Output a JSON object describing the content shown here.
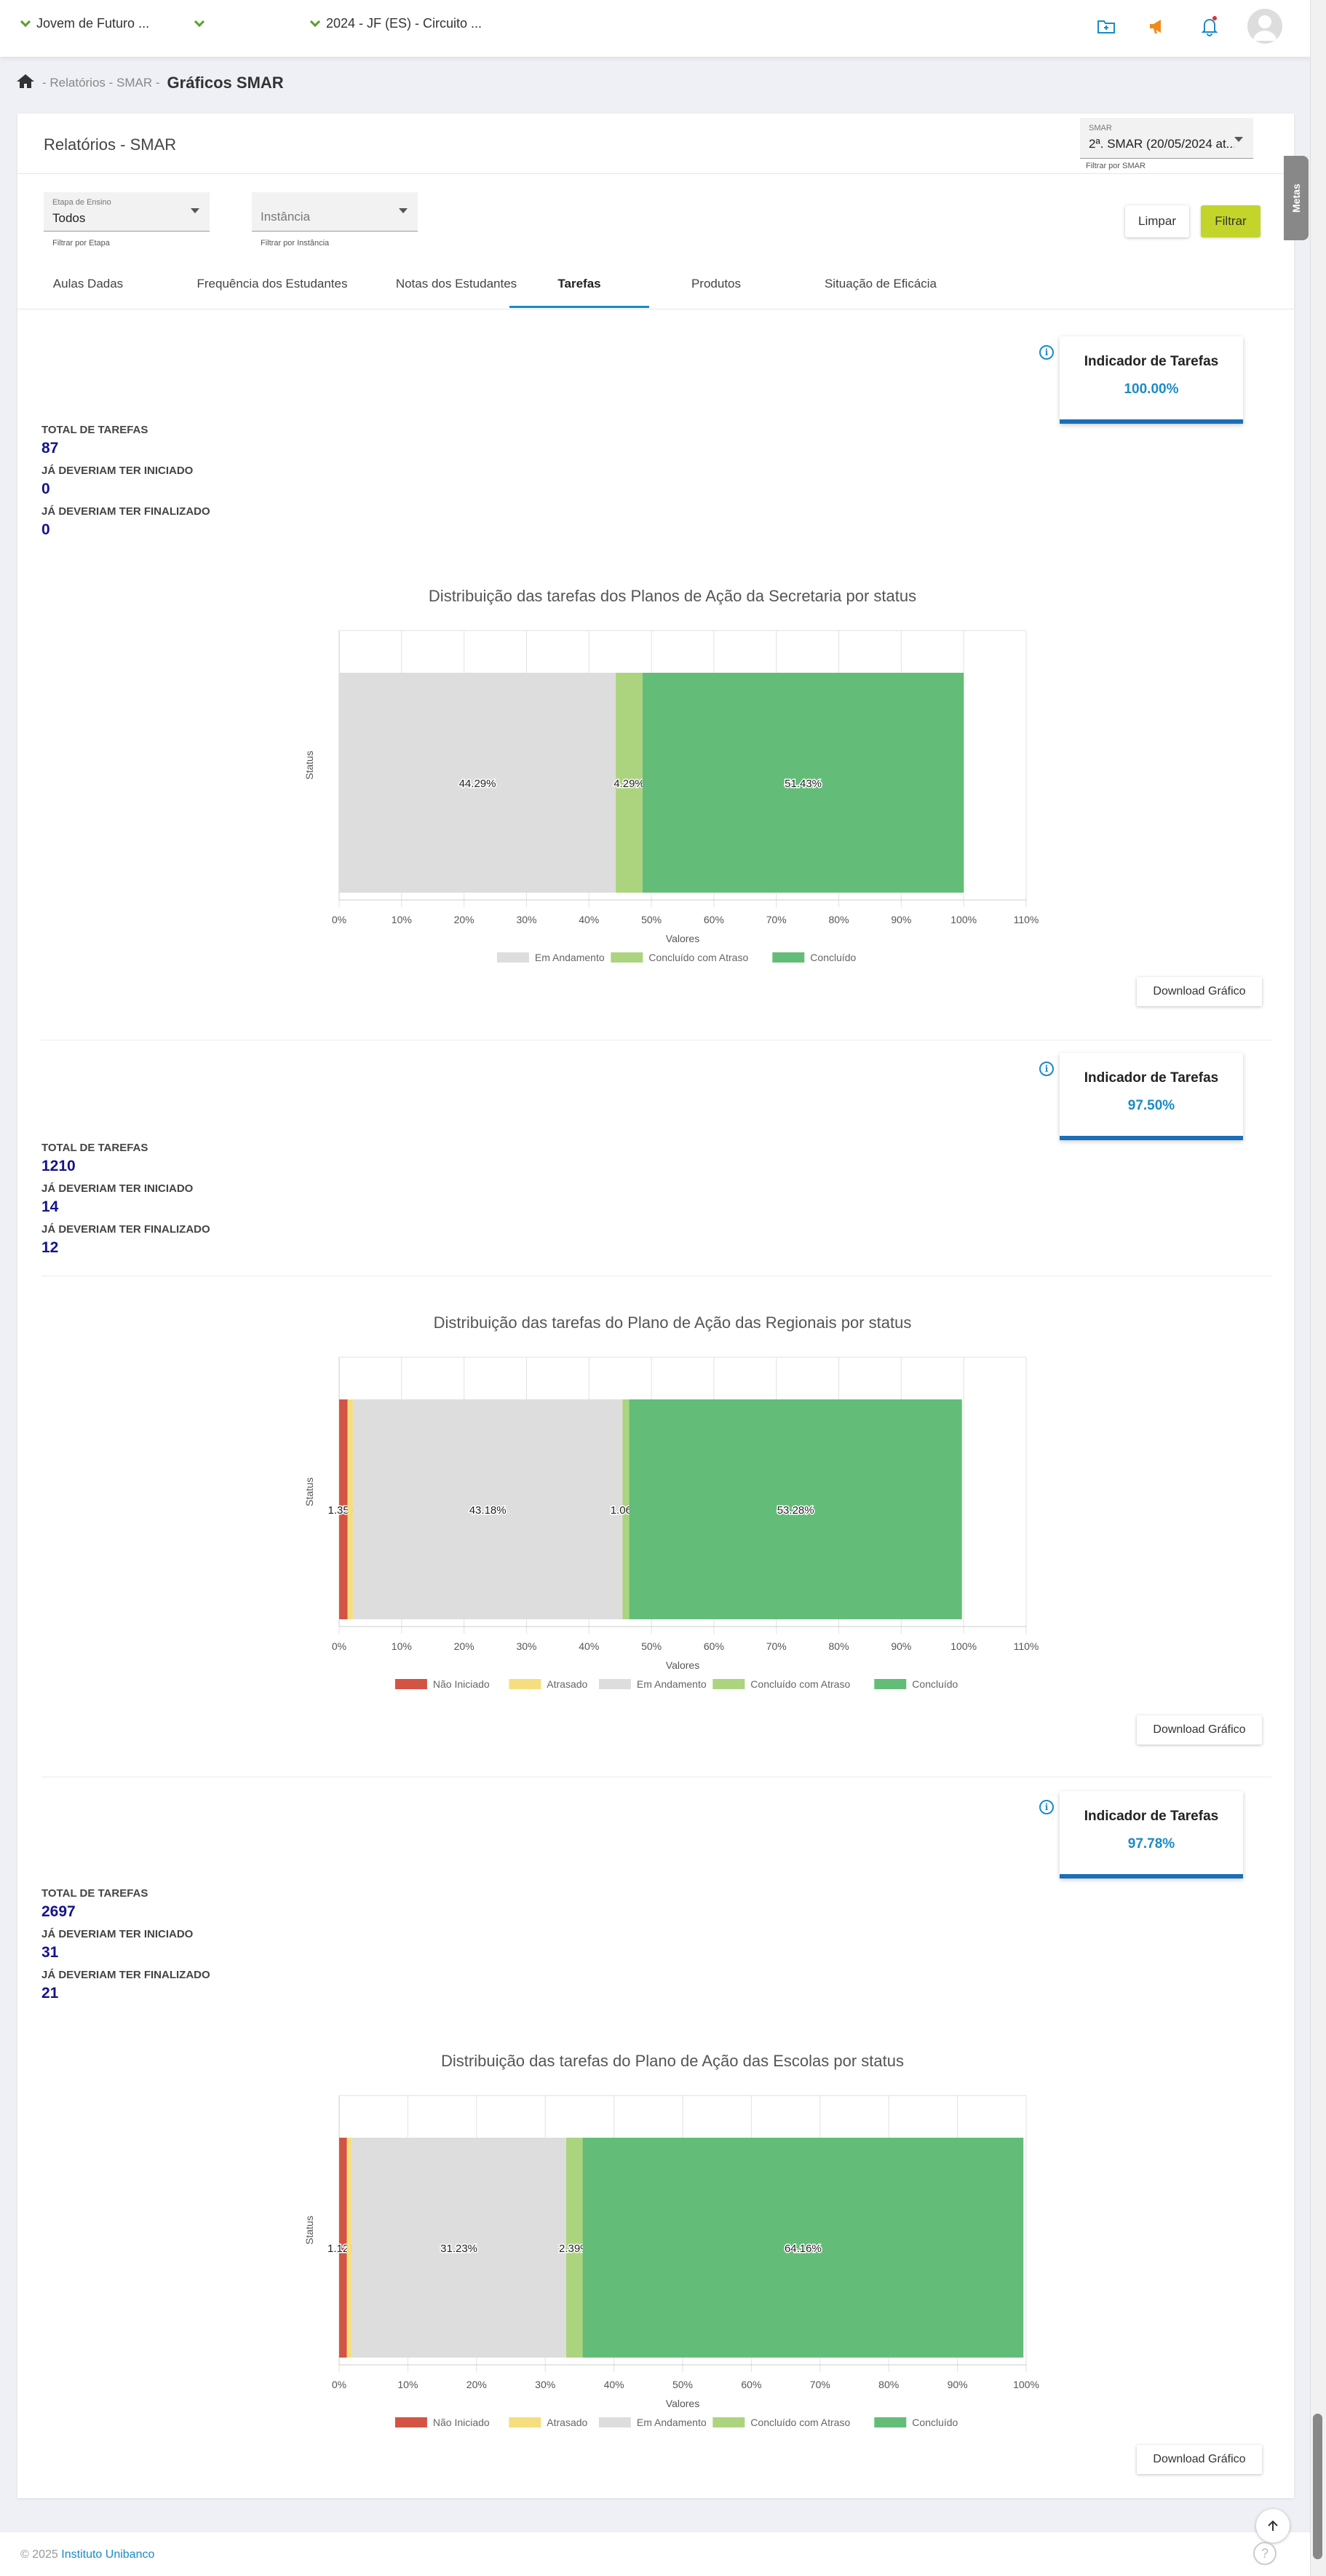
{
  "topbar": {
    "program_select": "Jovem de Futuro ...",
    "cycle_select": "2024 - JF (ES) - Circuito ...",
    "icons": [
      "folder-icon",
      "megaphone-icon",
      "bell-icon",
      "avatar-icon"
    ]
  },
  "metas_tab": "Metas",
  "breadcrumb": {
    "parent": "- Relatórios - SMAR -",
    "current": "Gráficos SMAR"
  },
  "card": {
    "title": "Relatórios - SMAR",
    "smar_filter": {
      "label": "SMAR",
      "value": "2ª. SMAR (20/05/2024 at...",
      "hint": "Filtrar por SMAR"
    },
    "etapa_filter": {
      "label": "Etapa de Ensino",
      "value": "Todos",
      "hint": "Filtrar por Etapa"
    },
    "instancia_filter": {
      "placeholder": "Instância",
      "hint": "Filtrar por Instância"
    },
    "clear_label": "Limpar",
    "filter_label": "Filtrar"
  },
  "tabs": [
    "Aulas Dadas",
    "Frequência dos Estudantes",
    "Notas dos Estudantes",
    "Tarefas",
    "Produtos",
    "Situação de Eficácia"
  ],
  "active_tab": "Tarefas",
  "sections": [
    {
      "indicator_title": "Indicador de Tarefas",
      "indicator_value": "100.00%",
      "stats": [
        {
          "label": "TOTAL DE TAREFAS",
          "value": "87"
        },
        {
          "label": "JÁ DEVERIAM TER INICIADO",
          "value": "0"
        },
        {
          "label": "JÁ DEVERIAM TER FINALIZADO",
          "value": "0"
        }
      ],
      "download_label": "Download Gráfico"
    },
    {
      "indicator_title": "Indicador de Tarefas",
      "indicator_value": "97.50%",
      "stats": [
        {
          "label": "TOTAL DE TAREFAS",
          "value": "1210"
        },
        {
          "label": "JÁ DEVERIAM TER INICIADO",
          "value": "14"
        },
        {
          "label": "JÁ DEVERIAM TER FINALIZADO",
          "value": "12"
        }
      ],
      "download_label": "Download Gráfico"
    },
    {
      "indicator_title": "Indicador de Tarefas",
      "indicator_value": "97.78%",
      "stats": [
        {
          "label": "TOTAL DE TAREFAS",
          "value": "2697"
        },
        {
          "label": "JÁ DEVERIAM TER INICIADO",
          "value": "31"
        },
        {
          "label": "JÁ DEVERIAM TER FINALIZADO",
          "value": "21"
        }
      ],
      "download_label": "Download Gráfico"
    }
  ],
  "chart_data": [
    {
      "type": "bar",
      "orientation": "horizontal-stacked",
      "title": "Distribuição das tarefas dos Planos de Ação da Secretaria por status",
      "xlabel": "Valores",
      "ylabel": "Status",
      "xlim": [
        0,
        110
      ],
      "xticks": [
        "0%",
        "10%",
        "20%",
        "30%",
        "40%",
        "50%",
        "60%",
        "70%",
        "80%",
        "90%",
        "100%",
        "110%"
      ],
      "series": [
        {
          "name": "Em Andamento",
          "value": 44.29,
          "label": "44.29%",
          "color": "#dddddd"
        },
        {
          "name": "Concluído com Atraso",
          "value": 4.29,
          "label": "4.29%",
          "color": "#acd47f"
        },
        {
          "name": "Concluído",
          "value": 51.43,
          "label": "51.43%",
          "color": "#63bd79"
        }
      ],
      "legend": [
        "Em Andamento",
        "Concluído com Atraso",
        "Concluído"
      ],
      "legend_position": "bottom",
      "grid": true
    },
    {
      "type": "bar",
      "orientation": "horizontal-stacked",
      "title": "Distribuição das tarefas do Plano de Ação das Regionais por status",
      "xlabel": "Valores",
      "ylabel": "Status",
      "xlim": [
        0,
        110
      ],
      "xticks": [
        "0%",
        "10%",
        "20%",
        "30%",
        "40%",
        "50%",
        "60%",
        "70%",
        "80%",
        "90%",
        "100%",
        "110%"
      ],
      "series": [
        {
          "name": "Não Iniciado",
          "value": 1.35,
          "label": "1.35%",
          "color": "#d35444"
        },
        {
          "name": "Atrasado",
          "value": 0.85,
          "label": "",
          "color": "#f6de7f"
        },
        {
          "name": "Em Andamento",
          "value": 43.18,
          "label": "43.18%",
          "color": "#dddddd"
        },
        {
          "name": "Concluído com Atraso",
          "value": 1.06,
          "label": "1.06%",
          "color": "#acd47f"
        },
        {
          "name": "Concluído",
          "value": 53.28,
          "label": "53.28%",
          "color": "#63bd79"
        }
      ],
      "legend": [
        "Não Iniciado",
        "Atrasado",
        "Em Andamento",
        "Concluído com Atraso",
        "Concluído"
      ],
      "legend_position": "bottom",
      "grid": true
    },
    {
      "type": "bar",
      "orientation": "horizontal-stacked",
      "title": "Distribuição das tarefas do Plano de Ação das Escolas por status",
      "xlabel": "Valores",
      "ylabel": "Status",
      "xlim": [
        0,
        100
      ],
      "xticks": [
        "0%",
        "10%",
        "20%",
        "30%",
        "40%",
        "50%",
        "60%",
        "70%",
        "80%",
        "90%",
        "100%"
      ],
      "series": [
        {
          "name": "Não Iniciado",
          "value": 1.12,
          "label": "1.12%",
          "color": "#d35444"
        },
        {
          "name": "Atrasado",
          "value": 0.7,
          "label": "",
          "color": "#f6de7f"
        },
        {
          "name": "Em Andamento",
          "value": 31.23,
          "label": "31.23%",
          "color": "#dddddd"
        },
        {
          "name": "Concluído com Atraso",
          "value": 2.39,
          "label": "2.39%",
          "color": "#acd47f"
        },
        {
          "name": "Concluído",
          "value": 64.16,
          "label": "64.16%",
          "color": "#63bd79"
        }
      ],
      "legend": [
        "Não Iniciado",
        "Atrasado",
        "Em Andamento",
        "Concluído com Atraso",
        "Concluído"
      ],
      "legend_position": "bottom",
      "grid": true
    }
  ],
  "footer": {
    "copyright": "© 2025",
    "company": "Instituto Unibanco"
  }
}
